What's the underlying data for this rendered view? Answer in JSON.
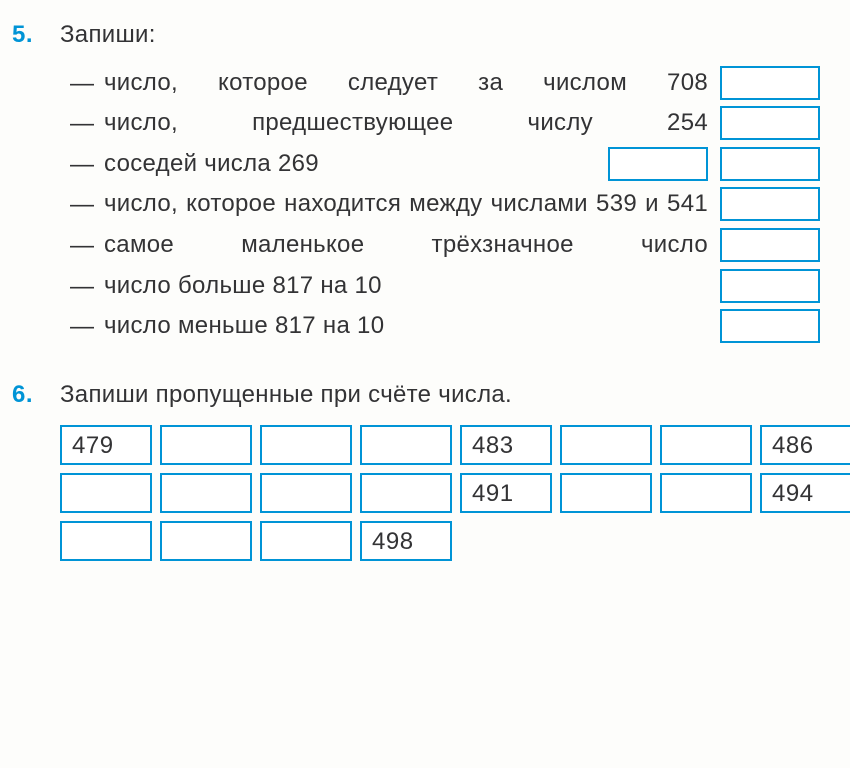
{
  "ex5": {
    "number": "5.",
    "prompt": "Запиши:",
    "items": [
      {
        "text": "число, которое следует за числом 708",
        "justify": true,
        "inlineBox": false
      },
      {
        "text": "число, предшествующее числу 254",
        "justify": true,
        "inlineBox": false
      },
      {
        "text": "соседей числа 269",
        "justify": false,
        "inlineBox": true
      },
      {
        "text": "число, которое находится между числами 539 и 541",
        "justify": true,
        "inlineBox": false
      },
      {
        "text": "самое маленькое трёхзначное число",
        "justify": true,
        "inlineBox": false
      },
      {
        "text": "число больше 817 на 10",
        "justify": false,
        "inlineBox": false
      },
      {
        "text": "число меньше 817 на 10",
        "justify": false,
        "inlineBox": false
      }
    ]
  },
  "ex6": {
    "number": "6.",
    "prompt": "Запиши пропущенные при счёте числа.",
    "grid": [
      [
        "479",
        "",
        "",
        "",
        "483",
        "",
        "",
        "486"
      ],
      [
        "",
        "",
        "",
        "",
        "491",
        "",
        "",
        "494"
      ],
      [
        "",
        "",
        "",
        "498"
      ]
    ]
  },
  "dash": "—"
}
